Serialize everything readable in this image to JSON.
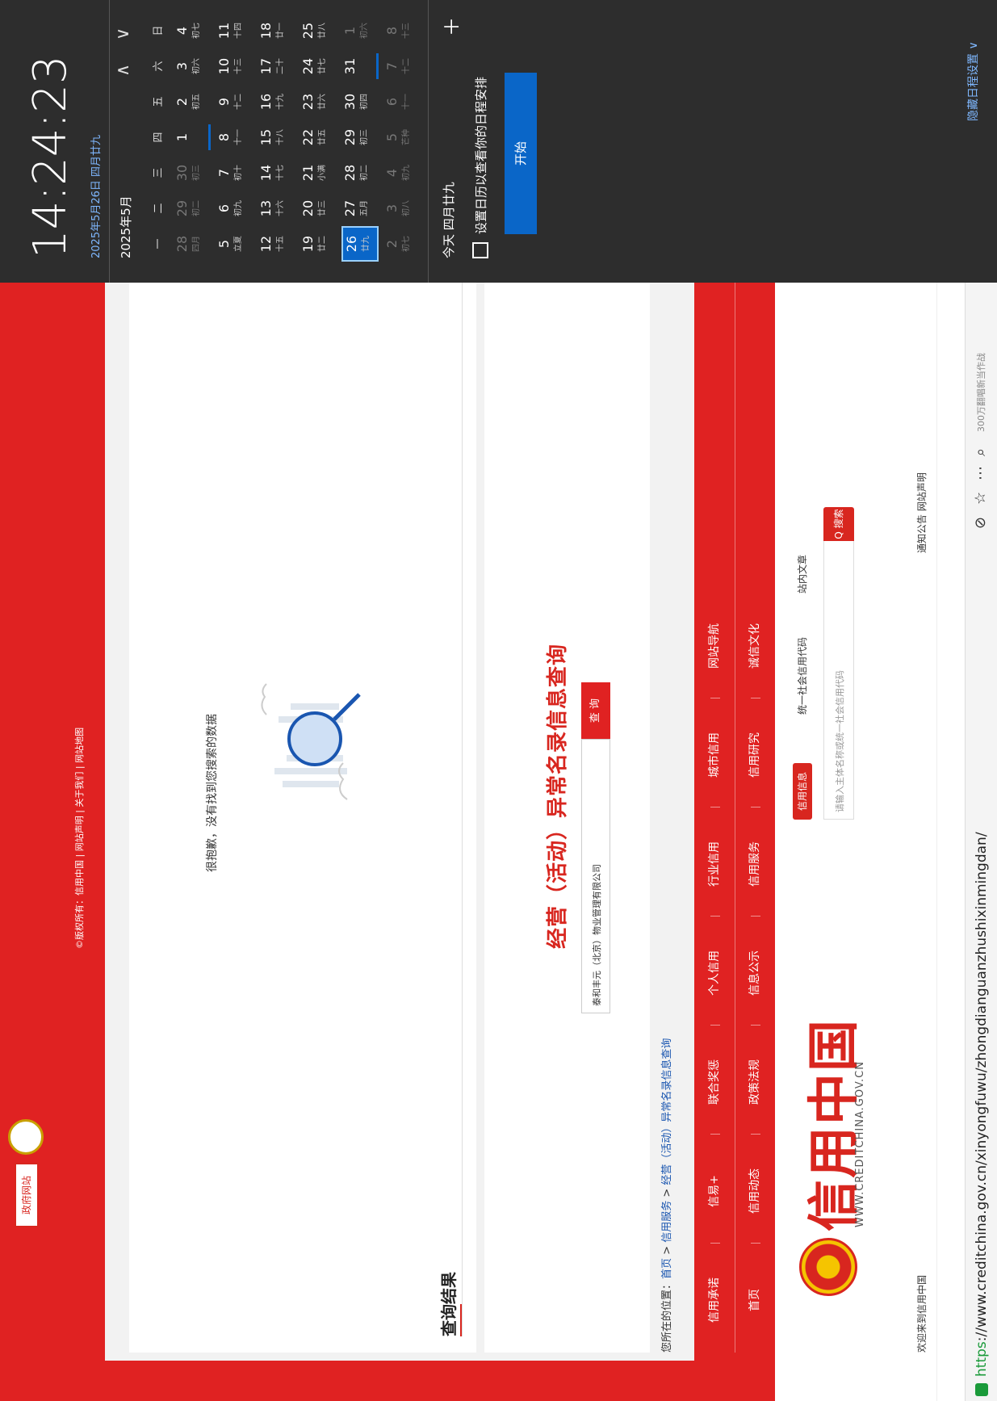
{
  "browser": {
    "url_proto": "https",
    "url_rest": "://www.creditchina.gov.cn/xinyongfuwu/zhongdianguanzhushixinmingdan/",
    "search_hint": "300万翻唱新当作战",
    "toolbar_icons": [
      "zoom-icon",
      "star-icon",
      "more-icon",
      "search-icon",
      "apps-icon",
      "favorites-icon",
      "cut-icon",
      "undo-icon",
      "menu-icon"
    ]
  },
  "site": {
    "welcome": "欢迎来到信用中国",
    "top_links": "通知公告   网站声明",
    "logo_cn": "信用中国",
    "logo_en": "WWW.CREDITCHINA.GOV.CN",
    "search": {
      "tab_active": "信用信息",
      "tab_2": "统一社会信用代码",
      "tab_3": "站内文章",
      "placeholder": "请输入主体名称或统一社会信用代码",
      "button": "Q 搜索"
    },
    "nav_row1": [
      "首页",
      "信用动态",
      "政策法规",
      "信息公示",
      "信用服务",
      "信用研究",
      "诚信文化"
    ],
    "nav_row2": [
      "信用承诺",
      "信易+",
      "联合奖惩",
      "个人信用",
      "行业信用",
      "城市信用",
      "网站导航"
    ],
    "breadcrumb": {
      "prefix": "您所在的位置：",
      "home": "首页",
      "sep": " > ",
      "service": "信用服务",
      "current": "经营（活动）异常名录信息查询"
    },
    "query": {
      "title": "经营（活动）异常名录信息查询",
      "input_value": "泰和丰元（北京）物业管理有限公司",
      "button": "查 询"
    },
    "results": {
      "title": "查询结果",
      "empty": "很抱歉，没有找到您搜索的数据"
    },
    "footer": {
      "copyright": "©版权所有：信用中国 | 网站声明 | 关于我们 | 网站地图",
      "gov_badge": "政府网站"
    }
  },
  "flyout": {
    "time": "14:24:23",
    "date": "2025年5月26日 四月廿九",
    "month": "2025年5月",
    "weekdays": [
      "一",
      "二",
      "三",
      "四",
      "五",
      "六",
      "日"
    ],
    "weeks": [
      [
        [
          "28",
          "四月"
        ],
        [
          "29",
          "初二"
        ],
        [
          "30",
          "初三"
        ],
        [
          "1",
          ""
        ],
        [
          "2",
          "初五"
        ],
        [
          "3",
          "初六"
        ],
        [
          "4",
          "初七"
        ]
      ],
      [
        [
          "5",
          "立夏"
        ],
        [
          "6",
          "初九"
        ],
        [
          "7",
          "初十"
        ],
        [
          "8",
          "十一"
        ],
        [
          "9",
          "十二"
        ],
        [
          "10",
          "十三"
        ],
        [
          "11",
          "十四"
        ]
      ],
      [
        [
          "12",
          "十五"
        ],
        [
          "13",
          "十六"
        ],
        [
          "14",
          "十七"
        ],
        [
          "15",
          "十八"
        ],
        [
          "16",
          "十九"
        ],
        [
          "17",
          "二十"
        ],
        [
          "18",
          "廿一"
        ]
      ],
      [
        [
          "19",
          "廿二"
        ],
        [
          "20",
          "廿三"
        ],
        [
          "21",
          "小满"
        ],
        [
          "22",
          "廿五"
        ],
        [
          "23",
          "廿六"
        ],
        [
          "24",
          "廿七"
        ],
        [
          "25",
          "廿八"
        ]
      ],
      [
        [
          "26",
          "廿九"
        ],
        [
          "27",
          "五月"
        ],
        [
          "28",
          "初二"
        ],
        [
          "29",
          "初三"
        ],
        [
          "30",
          "初四"
        ],
        [
          "31",
          ""
        ],
        [
          "1",
          "初六"
        ]
      ],
      [
        [
          "2",
          "初七"
        ],
        [
          "3",
          "初八"
        ],
        [
          "4",
          "初九"
        ],
        [
          "5",
          "芒种"
        ],
        [
          "6",
          "十一"
        ],
        [
          "7",
          "十二"
        ],
        [
          "8",
          "十三"
        ]
      ]
    ],
    "today_label": "今天 四月廿九",
    "hint": "设置日历以查看你的日程安排",
    "start_button": "开始",
    "hide_link": "隐藏日程设置 ∨"
  }
}
